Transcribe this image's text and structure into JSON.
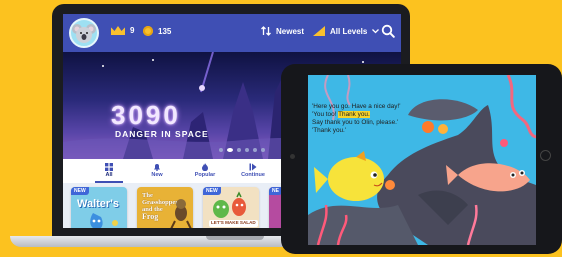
{
  "topbar": {
    "crowns": "9",
    "coins": "135",
    "sort_label": "Newest",
    "level_label": "All Levels"
  },
  "hero": {
    "title": "3090",
    "subtitle": "DANGER IN SPACE",
    "slide_count": 6,
    "active_slide": 1
  },
  "tabs": [
    {
      "label": "All",
      "icon": "grid-icon",
      "active": true
    },
    {
      "label": "New",
      "icon": "bell-icon",
      "active": false
    },
    {
      "label": "Popular",
      "icon": "flame-icon",
      "active": false
    },
    {
      "label": "Continue",
      "icon": "play-icon",
      "active": false
    }
  ],
  "books": [
    {
      "badge": "NEW",
      "title": "Walter's",
      "cover_color": "#7fcde8"
    },
    {
      "badge": "",
      "title_line1": "The",
      "title_line2": "Grasshopper",
      "title_line3": "and the",
      "title_line4": "Frog",
      "cover_color": "#e8b236"
    },
    {
      "badge": "NEW",
      "title": "LET'S MAKE SALAD",
      "cover_color": "#f2e1c2"
    },
    {
      "badge": "NE",
      "cover_color": "#b54ba0"
    }
  ],
  "reader": {
    "line1": "'Here you go. Have a nice day!'",
    "line2_pre": "'You too! ",
    "line2_hl": "Thank you.",
    "line3": "Say thank you to Olin, please.'",
    "line4": "'Thank you.'"
  },
  "colors": {
    "background": "#fcc21f",
    "topbar": "#3f4fb4",
    "highlight": "#f6d32b",
    "ocean": "#3eb8e6"
  }
}
